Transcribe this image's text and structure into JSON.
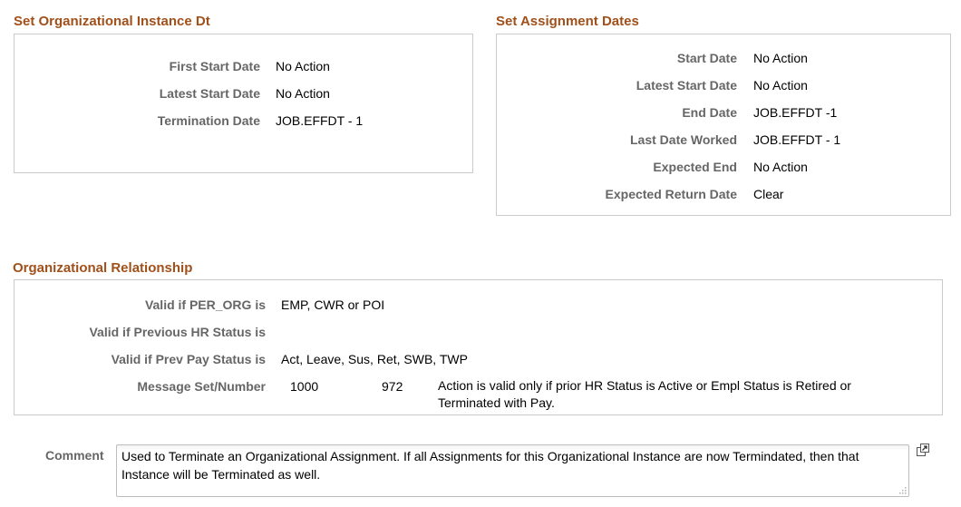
{
  "org_instance": {
    "title": "Set Organizational Instance Dt",
    "fields": [
      {
        "label": "First Start Date",
        "value": "No Action"
      },
      {
        "label": "Latest Start Date",
        "value": "No Action"
      },
      {
        "label": "Termination Date",
        "value": "JOB.EFFDT - 1"
      }
    ]
  },
  "assignment": {
    "title": "Set Assignment Dates",
    "fields": [
      {
        "label": "Start Date",
        "value": "No Action"
      },
      {
        "label": "Latest Start Date",
        "value": "No Action"
      },
      {
        "label": "End Date",
        "value": "JOB.EFFDT -1"
      },
      {
        "label": "Last Date Worked",
        "value": "JOB.EFFDT - 1"
      },
      {
        "label": "Expected End",
        "value": "No Action"
      },
      {
        "label": "Expected Return Date",
        "value": "Clear"
      }
    ]
  },
  "org_relationship": {
    "title": "Organizational Relationship",
    "per_org_label": "Valid if PER_ORG is",
    "per_org_value": "EMP, CWR or POI",
    "prev_hr_label": "Valid if Previous HR Status is",
    "prev_hr_value": "",
    "prev_pay_label": "Valid if Prev Pay Status is",
    "prev_pay_value": "Act, Leave, Sus, Ret, SWB, TWP",
    "message_label": "Message Set/Number",
    "message_set": "1000",
    "message_number": "972",
    "message_text": "Action is valid only if prior HR Status is Active or Empl Status is Retired or Terminated with Pay."
  },
  "comment": {
    "label": "Comment",
    "value": "Used to Terminate an Organizational Assignment. If all Assignments for this Organizational Instance are now Termindated, then that Instance will be Terminated as well.",
    "expand_icon": "expand-icon"
  },
  "colors": {
    "section_title": "#a0501a",
    "label": "#666666",
    "border": "#cbcbcb"
  }
}
